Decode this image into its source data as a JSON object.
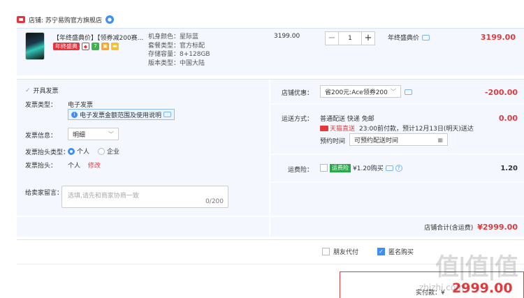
{
  "store": {
    "label": "店铺: 苏宁易购官方旗舰店"
  },
  "product": {
    "title": "【年终盛典价】【领券减200赛...",
    "badge": "年终盛典",
    "specs": [
      "机身颜色：星际蓝",
      "套餐类型：官方标配",
      "存储容量：8+128GB",
      "版本类型：中国大陆"
    ],
    "price": "3199.00",
    "quantity": "1",
    "promo": "年终盛典价",
    "total": "3199.00",
    "icon_seven": "7"
  },
  "invoice": {
    "check_label": "开具发票",
    "type_label": "发票类型：",
    "type_value": "电子发票",
    "note": "电子发票金额范围及使用说明",
    "info_label": "发票信息：",
    "info_value": "明细",
    "header_type_label": "发票抬头类型：",
    "opt_personal": "个人",
    "opt_company": "企业",
    "header_label": "发票抬头：",
    "header_value": "个人",
    "edit": "修改",
    "msg_label": "给卖家留言：",
    "msg_placeholder": "选填,请先和商家协商一致",
    "msg_count": "0/200"
  },
  "right": {
    "discount_label": "店铺优惠：",
    "discount_value": "省200元:Ace领券200",
    "discount_amount": "-200.00",
    "ship_label": "运送方式：",
    "ship_method": "普通配送 快递 免邮",
    "tmall_label": "天猫直送",
    "ship_note": "23:00前付款，预计12月13日(明天)送达",
    "time_label": "预约时间",
    "time_value": "可预约配送时间",
    "ship_amount": "0.00",
    "ins_label": "运费险：",
    "ins_badge": "运费险",
    "ins_value": "¥1.20购买",
    "ins_amount": "1.20",
    "sum_label": "店铺合计(含运费)",
    "sum_amount": "¥2999.00"
  },
  "footer": {
    "friend_pay": "朋友代付",
    "anon_buy": "匿名购买",
    "pay_label": "实付款：¥",
    "pay_amount": "2999.00",
    "watermark": "值|值|值",
    "watermark_url": "zhizhi.com"
  }
}
